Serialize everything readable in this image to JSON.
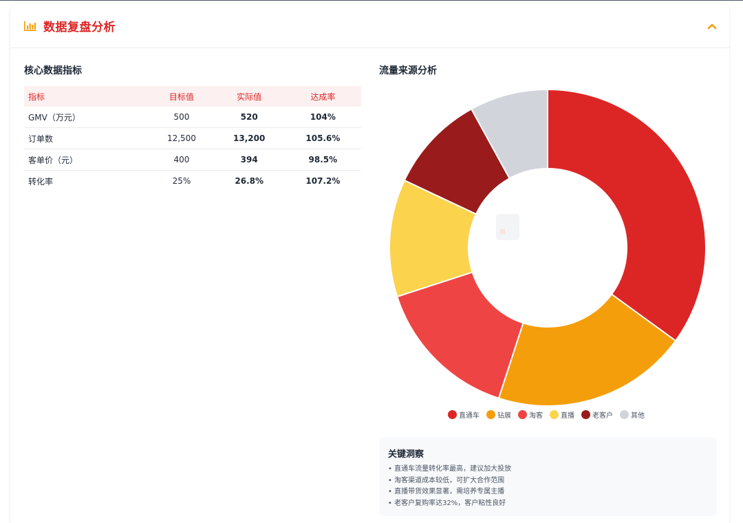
{
  "header": {
    "title": "数据复盘分析",
    "icon": "bar-chart-icon",
    "collapse_icon": "chevron-up-icon"
  },
  "metrics": {
    "title": "核心数据指标",
    "columns": [
      "指标",
      "目标值",
      "实际值",
      "达成率"
    ],
    "rows": [
      {
        "name": "GMV（万元）",
        "target": "500",
        "actual": "520",
        "rate": "104%"
      },
      {
        "name": "订单数",
        "target": "12,500",
        "actual": "13,200",
        "rate": "105.6%"
      },
      {
        "name": "客单价（元）",
        "target": "400",
        "actual": "394",
        "rate": "98.5%"
      },
      {
        "name": "转化率",
        "target": "25%",
        "actual": "26.8%",
        "rate": "107.2%"
      }
    ]
  },
  "traffic": {
    "title": "流量来源分析",
    "legend": [
      "直通车",
      "钻展",
      "淘客",
      "直播",
      "老客户",
      "其他"
    ]
  },
  "chart_data": {
    "type": "pie",
    "style": "donut",
    "categories": [
      "直通车",
      "钻展",
      "淘客",
      "直播",
      "老客户",
      "其他"
    ],
    "values": [
      35,
      20,
      15,
      12,
      10,
      8
    ],
    "colors": [
      "#dc2626",
      "#f59e0b",
      "#ef4444",
      "#fcd34d",
      "#991b1b",
      "#d1d5db"
    ],
    "legend_position": "bottom"
  },
  "insights": {
    "title": "关键洞察",
    "items": [
      "• 直通车流量转化率最高，建议加大投放",
      "• 淘客渠道成本较低，可扩大合作范围",
      "• 直播带货效果显著，需培养专属主播",
      "• 老客户复购率达32%，客户粘性良好"
    ]
  },
  "colors": {
    "accent": "#dc2626",
    "warning": "#f59e0b",
    "success": "#16a34a",
    "header_bg": "#fdf0f0"
  }
}
